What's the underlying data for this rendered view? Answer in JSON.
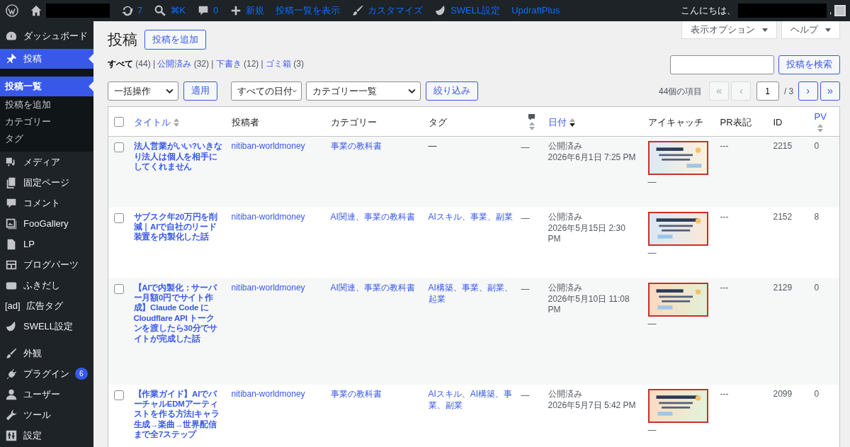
{
  "admin_bar": {
    "left": [
      {
        "kind": "wp"
      },
      {
        "kind": "home",
        "redacted": true
      },
      {
        "kind": "updates",
        "label": "7"
      },
      {
        "kind": "search",
        "label": "⌘K"
      },
      {
        "kind": "comment",
        "label": "0"
      },
      {
        "kind": "plus",
        "label": "新規"
      },
      {
        "kind": "text",
        "label": "投稿一覧を表示"
      },
      {
        "kind": "brush",
        "label": "カスタマイズ"
      },
      {
        "kind": "swell",
        "label": "SWELL設定"
      },
      {
        "kind": "text",
        "label": "UpdraftPlus"
      }
    ],
    "greeting": "こんにちは、",
    "greeting_suffix": ","
  },
  "sidebar": {
    "items": [
      {
        "kind": "dashboard",
        "label": "ダッシュボード",
        "selected": false
      },
      {
        "kind": "pin",
        "label": "投稿",
        "selected": true,
        "children": [
          {
            "label": "投稿一覧",
            "selected": true
          },
          {
            "label": "投稿を追加",
            "selected": false
          },
          {
            "label": "カテゴリー",
            "selected": false
          },
          {
            "label": "タグ",
            "selected": false
          }
        ]
      },
      {
        "kind": "media",
        "label": "メディア",
        "selected": false
      },
      {
        "kind": "pages",
        "label": "固定ページ",
        "selected": false
      },
      {
        "kind": "comment",
        "label": "コメント",
        "selected": false
      },
      {
        "kind": "gallery",
        "label": "FooGallery",
        "selected": false
      },
      {
        "kind": "page",
        "label": "LP",
        "selected": false
      },
      {
        "kind": "blocks",
        "label": "ブログパーツ",
        "selected": false
      },
      {
        "kind": "balloon",
        "label": "ふきだし",
        "selected": false
      },
      {
        "kind": "ad",
        "label": "広告タグ",
        "icon_text": "[ad]",
        "selected": false
      },
      {
        "kind": "swell",
        "label": "SWELL設定",
        "selected": false
      },
      {
        "kind": "brush",
        "label": "外観",
        "selected": false,
        "gap": true
      },
      {
        "kind": "plug",
        "label": "プラグイン",
        "badge": "6",
        "selected": false
      },
      {
        "kind": "user",
        "label": "ユーザー",
        "selected": false
      },
      {
        "kind": "wrench",
        "label": "ツール",
        "selected": false
      },
      {
        "kind": "settings",
        "label": "設定",
        "selected": false
      }
    ]
  },
  "header": {
    "title": "投稿",
    "add_button": "投稿を追加",
    "screen_options": "表示オプション",
    "help": "ヘルプ"
  },
  "status_separator": "|",
  "status_links": [
    {
      "label": "すべて",
      "count": "(44)",
      "selected": true
    },
    {
      "label": "公開済み",
      "count": "(32)",
      "selected": false
    },
    {
      "label": "下書き",
      "count": "(12)",
      "selected": false
    },
    {
      "label": "ゴミ箱",
      "count": "(3)",
      "selected": false
    }
  ],
  "search": {
    "button": "投稿を検索"
  },
  "filters": {
    "bulk": "一括操作",
    "apply": "適用",
    "dates": "すべての日付",
    "category": "カテゴリー一覧",
    "filter": "絞り込み"
  },
  "pagination": {
    "count": "44個の項目",
    "first": "«",
    "prev": "‹",
    "page": "1",
    "total": "/ 3",
    "next": "›",
    "last": "»",
    "first_disabled": true,
    "prev_disabled": true
  },
  "table": {
    "select_all": {
      "checked": false
    },
    "columns": [
      {
        "kind": "title",
        "label": "タイトル",
        "sortable": true,
        "sorted_desc": false
      },
      {
        "kind": "text",
        "label": "投稿者"
      },
      {
        "kind": "text",
        "label": "カテゴリー"
      },
      {
        "kind": "text",
        "label": "タグ"
      },
      {
        "kind": "comments",
        "sortable": true,
        "sorted_desc": false
      },
      {
        "kind": "text",
        "label": "日付",
        "sortable": true,
        "sorted_desc": true
      },
      {
        "kind": "text",
        "label": "アイキャッチ"
      },
      {
        "kind": "text",
        "label": "PR表記"
      },
      {
        "kind": "text",
        "label": "ID"
      },
      {
        "kind": "text",
        "label": "PV",
        "sortable": true,
        "sorted_desc": false
      }
    ],
    "rows": [
      {
        "checked": false,
        "title": "法人営業がいい?いきなり法人は個人を相手にしてくれません",
        "author": "nitiban-worldmoney",
        "categories": "事業の教科書",
        "tags": "—",
        "comments": "—",
        "status": "公開済み",
        "date": "2026年6月1日 7:25 PM",
        "thumb_note": "—",
        "pr": "---",
        "id": "2215",
        "pv": "0"
      },
      {
        "checked": false,
        "title": "サブスク年20万円を削減｜AIで自社のリード装置を内製化した話",
        "author": "nitiban-worldmoney",
        "categories": "AI関連、事業の教科書",
        "tags": "AIスキル、事業、副業",
        "comments": "—",
        "status": "公開済み",
        "date": "2026年5月15日 2:30 PM",
        "thumb_note": "—",
        "pr": "---",
        "id": "2152",
        "pv": "8"
      },
      {
        "checked": false,
        "title": "【AIで内製化：サーバー月額0円でサイト作成】Claude Code にCloudflare API トークンを渡したら30分でサイトが完成した話",
        "author": "nitiban-worldmoney",
        "categories": "AI関連、事業の教科書",
        "tags": "AI構築、事業、副業、起業",
        "comments": "—",
        "status": "公開済み",
        "date": "2026年5月10日 11:08 PM",
        "thumb_note": "—",
        "pr": "---",
        "id": "2129",
        "pv": "0"
      },
      {
        "checked": false,
        "title": "【作業ガイド】AIでバーチャルEDMアーティストを作る方法|キャラ生成→楽曲→世界配信まで全7ステップ",
        "author": "nitiban-worldmoney",
        "categories": "事業の教科書",
        "tags": "AIスキル、AI構築、事業、副業",
        "comments": "—",
        "status": "公開済み",
        "date": "2026年5月7日 5:42 PM",
        "thumb_note": "—",
        "pr": "---",
        "id": "2099",
        "pv": "0"
      }
    ]
  }
}
